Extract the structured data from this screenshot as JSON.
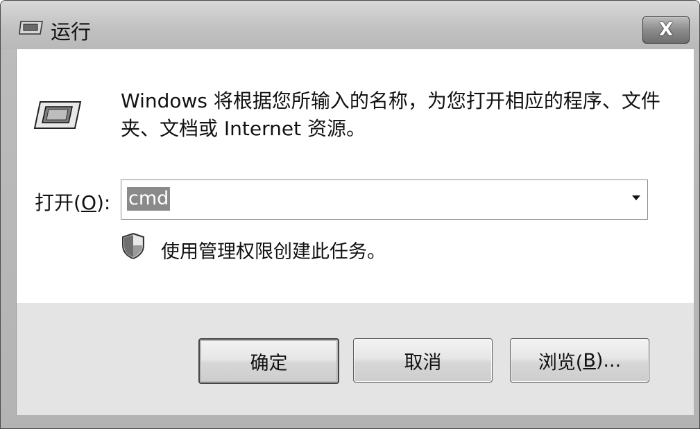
{
  "window": {
    "title": "运行",
    "close_label": "X"
  },
  "content": {
    "description": "Windows 将根据您所输入的名称，为您打开相应的程序、文件夹、文档或 Internet 资源。",
    "open_label": "打开(",
    "open_accel": "O",
    "open_label_suffix": "):",
    "input_value": "cmd",
    "admin_note": "使用管理权限创建此任务。"
  },
  "buttons": {
    "ok": "确定",
    "cancel": "取消",
    "browse_prefix": "浏览(",
    "browse_accel": "B",
    "browse_suffix": ")..."
  },
  "icons": {
    "title": "run-icon",
    "run": "run-icon",
    "admin": "uac-shield-icon",
    "dropdown": "chevron-down-icon"
  }
}
